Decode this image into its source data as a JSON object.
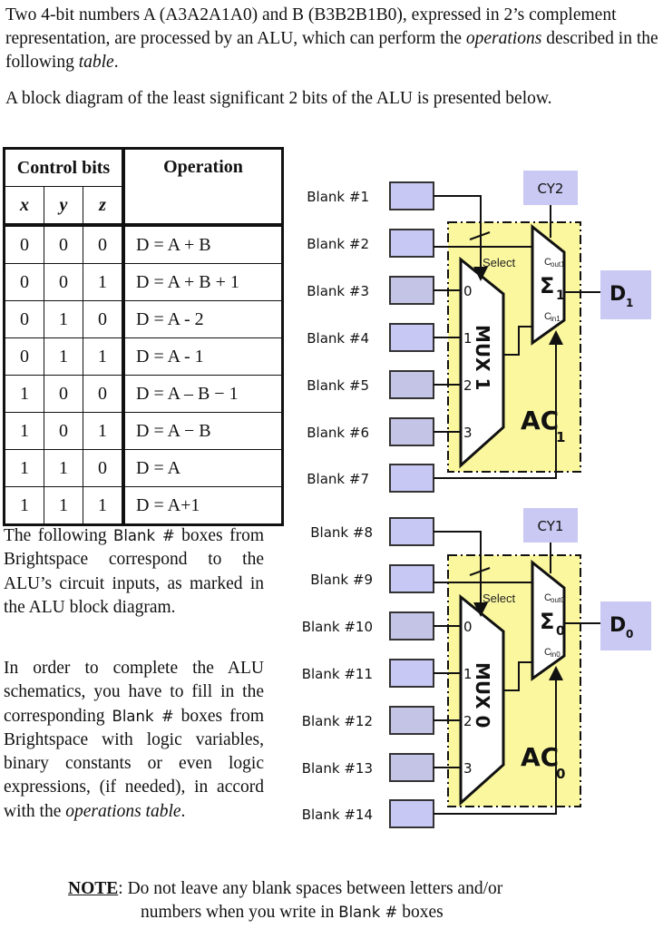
{
  "intro": {
    "p1_a": "Two 4-bit numbers A (A3A2A1A0) and B (B3B2B1B0), expressed in 2’s complement representation, are processed by an ALU, which can perform the ",
    "p1_em1": "operations",
    "p1_b": " described in the following ",
    "p1_em2": "table",
    "p1_c": ".",
    "p2": "A block diagram of the least significant 2 bits of the ALU is presented below."
  },
  "table": {
    "header_control": "Control bits",
    "header_operation": "Operation",
    "col_x": "x",
    "col_y": "y",
    "col_z": "z",
    "rows": [
      {
        "x": "0",
        "y": "0",
        "z": "0",
        "op": "D = A + B"
      },
      {
        "x": "0",
        "y": "0",
        "z": "1",
        "op": "D = A + B + 1"
      },
      {
        "x": "0",
        "y": "1",
        "z": "0",
        "op": "D = A - 2"
      },
      {
        "x": "0",
        "y": "1",
        "z": "1",
        "op": "D = A - 1"
      },
      {
        "x": "1",
        "y": "0",
        "z": "0",
        "op": "D = A – B − 1"
      },
      {
        "x": "1",
        "y": "0",
        "z": "1",
        "op": "D = A − B"
      },
      {
        "x": "1",
        "y": "1",
        "z": "0",
        "op": "D = A"
      },
      {
        "x": "1",
        "y": "1",
        "z": "1",
        "op": "D = A+1"
      }
    ]
  },
  "side": {
    "p1_a": "The following ",
    "p1_blank": "Blank #",
    "p1_b": " boxes from Brightspace correspond to the ALU’s circuit inputs, as marked in the ALU block diagram.",
    "p2_a": "In order to complete the ALU schematics, you have to fill in the corresponding ",
    "p2_blank": "Blank #",
    "p2_b": " boxes from Brightspace with logic variables, binary constants or even logic expressions, (if needed), in accord with the ",
    "p2_em": "operations table",
    "p2_c": "."
  },
  "note": {
    "label": "NOTE",
    "colon": ":",
    "line1": " Do not leave any blank spaces between letters and/or",
    "line2_a": "numbers when you write in ",
    "line2_blank": "Blank #",
    "line2_b": " boxes"
  },
  "diagram": {
    "colors": {
      "blank_box": "#c8c8f5",
      "blank_box_alt": "#c4c4e6",
      "output_box": "#c9c9f3",
      "ac_fill": "#fbf79e",
      "line": "#111111"
    },
    "blanks": [
      "Blank #1",
      "Blank #2",
      "Blank #3",
      "Blank #4",
      "Blank #5",
      "Blank #6",
      "Blank #7",
      "Blank #8",
      "Blank #9",
      "Blank #10",
      "Blank #11",
      "Blank #12",
      "Blank #13",
      "Blank #14"
    ],
    "stages": [
      {
        "mux_label": "MUX 1",
        "select_label": "Select",
        "ports": [
          "0",
          "1",
          "2",
          "3"
        ],
        "adder_symbol": "Σ",
        "adder_sub": "1",
        "cout_main": "C",
        "cout_sub": "out1",
        "cin_main": "C",
        "cin_sub": "in1",
        "ac_main": "AC",
        "ac_sub": "1",
        "carry_label": "CY2",
        "out_main": "D",
        "out_sub": "1"
      },
      {
        "mux_label": "MUX 0",
        "select_label": "Select",
        "ports": [
          "0",
          "1",
          "2",
          "3"
        ],
        "adder_symbol": "Σ",
        "adder_sub": "0",
        "cout_main": "C",
        "cout_sub": "out0",
        "cin_main": "C",
        "cin_sub": "in0",
        "ac_main": "AC",
        "ac_sub": "0",
        "carry_label": "CY1",
        "out_main": "D",
        "out_sub": "0"
      }
    ]
  }
}
